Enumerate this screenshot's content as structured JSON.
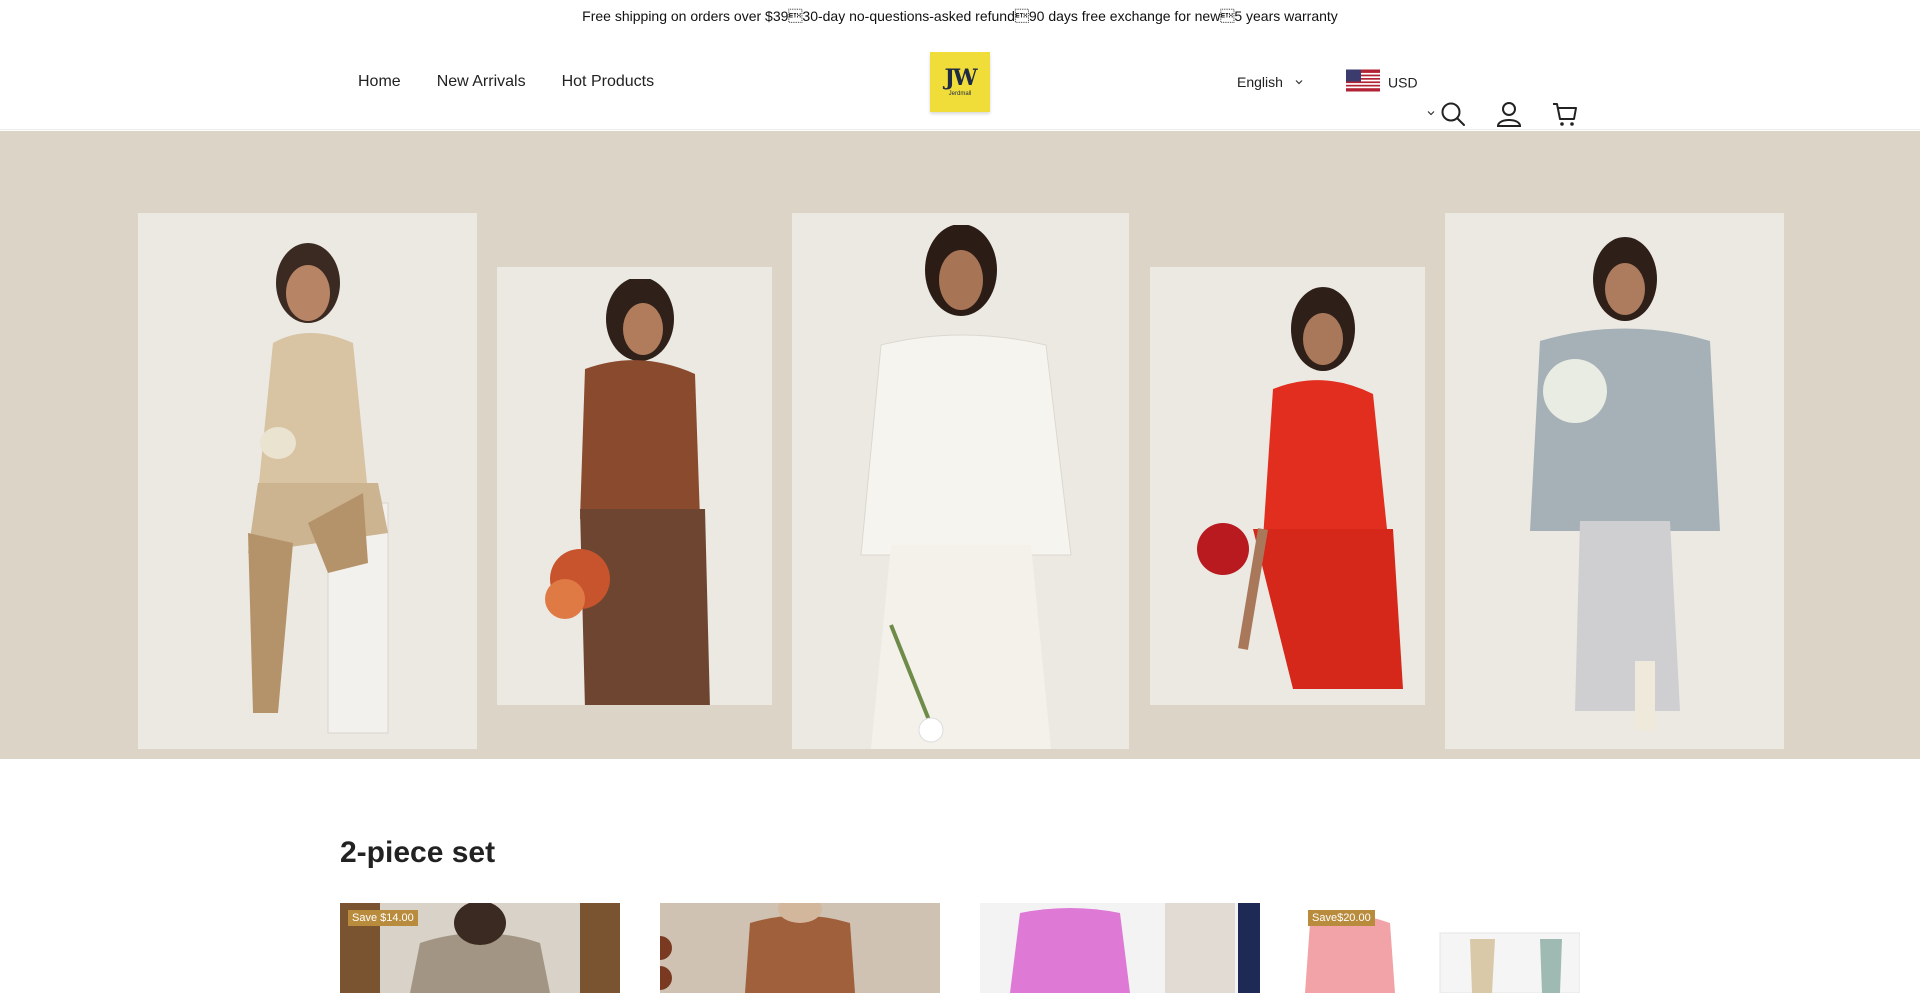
{
  "announcement": "Free shipping on orders over $39\u000330-day no-questions-asked refund\u000390 days free exchange for new\u00035 years warranty",
  "nav": {
    "home": "Home",
    "new_arrivals": "New Arrivals",
    "hot_products": "Hot Products"
  },
  "logo": {
    "mark": "JW",
    "word": "Jerdmall"
  },
  "header": {
    "language": "English",
    "currency": "USD",
    "icons": [
      "search-icon",
      "account-icon",
      "cart-icon"
    ]
  },
  "section": {
    "title": "2-piece set"
  },
  "products": [
    {
      "badge": "Save $14.00"
    },
    {
      "badge": ""
    },
    {
      "badge": ""
    },
    {
      "badge": "Save$20.00"
    }
  ],
  "colors": {
    "hero_bg": "#dcd4c6",
    "badge_bg": "#b98b3d",
    "logo_bg": "#f0dd3a"
  }
}
